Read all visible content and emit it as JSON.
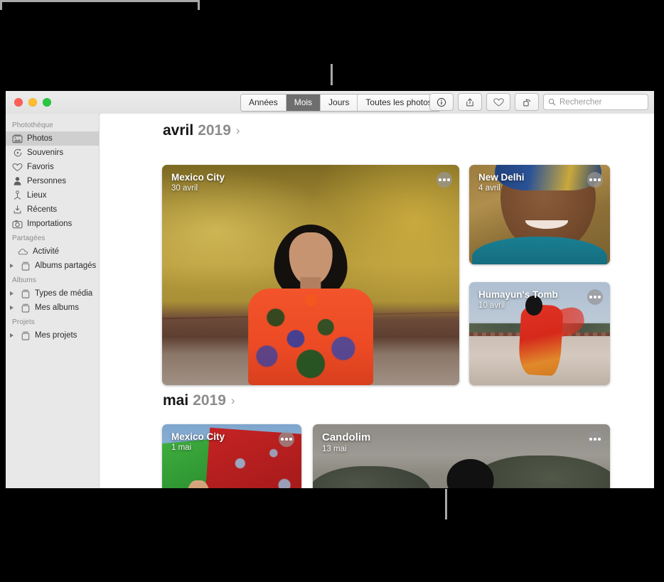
{
  "window": {
    "traffic_lights": [
      "close",
      "minimize",
      "zoom"
    ],
    "colors": {
      "close": "#ff5f57",
      "minimize": "#febc2e",
      "zoom": "#28c840",
      "selection": "#cfcfcf"
    }
  },
  "toolbar": {
    "segmented": {
      "options": [
        {
          "label": "Années",
          "selected": false
        },
        {
          "label": "Mois",
          "selected": true
        },
        {
          "label": "Jours",
          "selected": false
        },
        {
          "label": "Toutes les photos",
          "selected": false
        }
      ]
    },
    "buttons": [
      {
        "name": "info-button",
        "icon": "info-icon"
      },
      {
        "name": "share-button",
        "icon": "share-icon"
      },
      {
        "name": "favorite-button",
        "icon": "heart-icon"
      },
      {
        "name": "rotate-button",
        "icon": "rotate-icon"
      }
    ],
    "search": {
      "placeholder": "Rechercher",
      "value": "",
      "icon": "search-icon"
    }
  },
  "sidebar": {
    "sections": [
      {
        "header": "Photothèque",
        "items": [
          {
            "label": "Photos",
            "icon": "photos-icon",
            "selected": true,
            "disclosure": false
          },
          {
            "label": "Souvenirs",
            "icon": "memories-icon",
            "selected": false,
            "disclosure": false
          },
          {
            "label": "Favoris",
            "icon": "heart-icon",
            "selected": false,
            "disclosure": false
          },
          {
            "label": "Personnes",
            "icon": "person-icon",
            "selected": false,
            "disclosure": false
          },
          {
            "label": "Lieux",
            "icon": "pin-icon",
            "selected": false,
            "disclosure": false
          },
          {
            "label": "Récents",
            "icon": "download-icon",
            "selected": false,
            "disclosure": false
          },
          {
            "label": "Importations",
            "icon": "camera-icon",
            "selected": false,
            "disclosure": false
          }
        ]
      },
      {
        "header": "Partagées",
        "items": [
          {
            "label": "Activité",
            "icon": "cloud-icon",
            "selected": false,
            "disclosure": false
          },
          {
            "label": "Albums partagés",
            "icon": "album-icon",
            "selected": false,
            "disclosure": true
          }
        ]
      },
      {
        "header": "Albums",
        "items": [
          {
            "label": "Types de média",
            "icon": "album-icon",
            "selected": false,
            "disclosure": true
          },
          {
            "label": "Mes albums",
            "icon": "album-icon",
            "selected": false,
            "disclosure": true
          }
        ]
      },
      {
        "header": "Projets",
        "items": [
          {
            "label": "Mes projets",
            "icon": "album-icon",
            "selected": false,
            "disclosure": true
          }
        ]
      }
    ]
  },
  "content": {
    "months": [
      {
        "name": "avril",
        "year": "2019",
        "chevron": "›",
        "cards": [
          {
            "title": "Mexico City",
            "date": "30 avril",
            "more": "more-options"
          },
          {
            "title": "New Delhi",
            "date": "4 avril",
            "more": "more-options"
          },
          {
            "title": "Humayun's Tomb",
            "date": "10 avril",
            "more": "more-options"
          }
        ]
      },
      {
        "name": "mai",
        "year": "2019",
        "chevron": "›",
        "cards": [
          {
            "title": "Mexico City",
            "date": "1 mai",
            "more": "more-options"
          },
          {
            "title": "Candolim",
            "date": "13 mai",
            "more": "more-options"
          }
        ]
      }
    ]
  }
}
